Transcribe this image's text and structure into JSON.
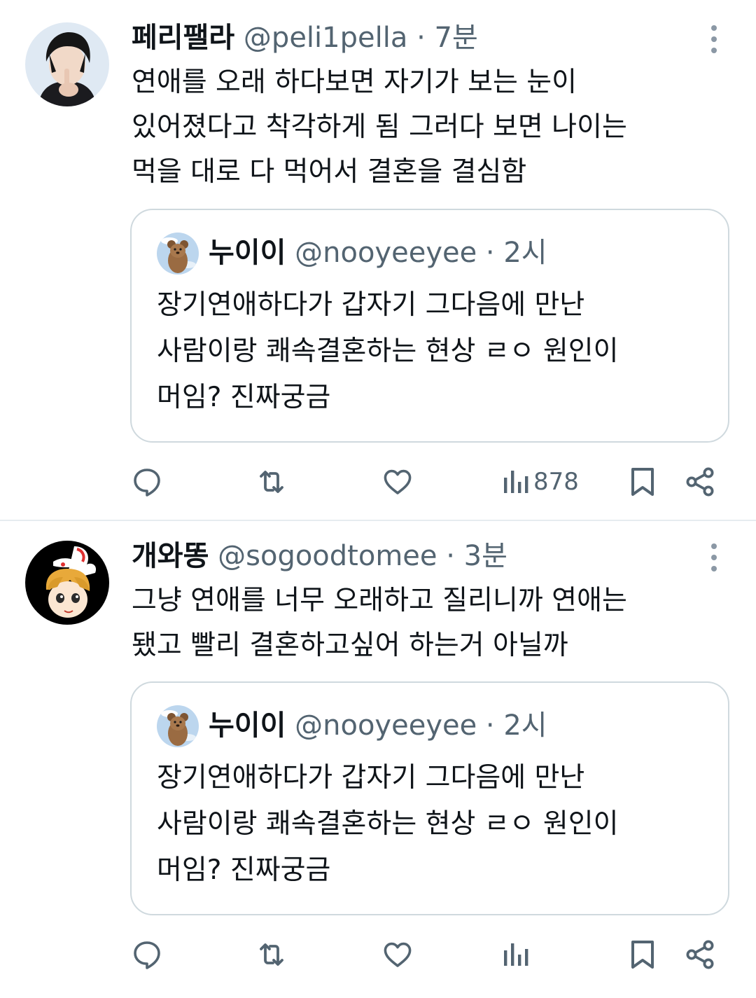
{
  "tweets": [
    {
      "name": "페리팰라",
      "handle": "@peli1pella",
      "separator": "·",
      "time": "7분",
      "lines": [
        "연애를 오래 하다보면 자기가 보는 눈이",
        "있어졌다고 착각하게 됨 그러다 보면 나이는",
        "먹을 대로 다 먹어서 결혼을 결심함"
      ],
      "quote": {
        "name": "누이이",
        "handle": "@nooyeeyee",
        "separator": "·",
        "time": "2시",
        "lines": [
          "장기연애하다가 갑자기 그다음에 만난",
          "사람이랑 쾌속결혼하는 현상 ㄹㅇ 원인이",
          "머임? 진짜궁금"
        ]
      },
      "views": "878"
    },
    {
      "name": "개와똥",
      "handle": "@sogoodtomee",
      "separator": "·",
      "time": "3분",
      "lines": [
        "그냥 연애를 너무 오래하고 질리니까 연애는",
        "됐고 빨리 결혼하고싶어 하는거 아닐까"
      ],
      "quote": {
        "name": "누이이",
        "handle": "@nooyeeyee",
        "separator": "·",
        "time": "2시",
        "lines": [
          "장기연애하다가 갑자기 그다음에 만난",
          "사람이랑 쾌속결혼하는 현상 ㄹㅇ 원인이",
          "머임? 진짜궁금"
        ]
      },
      "views": ""
    }
  ],
  "icons": {
    "reply": "reply-icon",
    "retweet": "retweet-icon",
    "like": "heart-icon",
    "views": "views-chart-icon",
    "bookmark": "bookmark-icon",
    "share": "share-icon",
    "more": "more-vertical-icon"
  },
  "colors": {
    "text": "#0f1419",
    "secondary": "#536471",
    "border": "#cfd9de"
  }
}
